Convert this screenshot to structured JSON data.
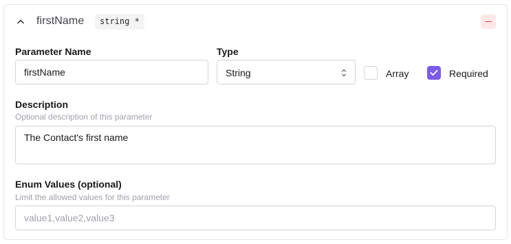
{
  "header": {
    "title": "firstName",
    "type_badge": "string *",
    "collapse_icon": "chevron-up-icon",
    "remove_icon": "minus-icon"
  },
  "parameter_name": {
    "label": "Parameter Name",
    "value": "firstName"
  },
  "type": {
    "label": "Type",
    "selected": "String"
  },
  "array": {
    "label": "Array",
    "checked": false
  },
  "required": {
    "label": "Required",
    "checked": true
  },
  "description": {
    "label": "Description",
    "hint": "Optional description of this parameter",
    "value": "The Contact's first name"
  },
  "enum_values": {
    "label": "Enum Values (optional)",
    "hint": "Limit the allowed values for this parameter",
    "placeholder": "value1,value2,value3",
    "value": ""
  },
  "colors": {
    "accent": "#7c5ce6",
    "danger": "#ef4444",
    "danger_bg": "#fde8e8",
    "border": "#d4d4d8"
  }
}
